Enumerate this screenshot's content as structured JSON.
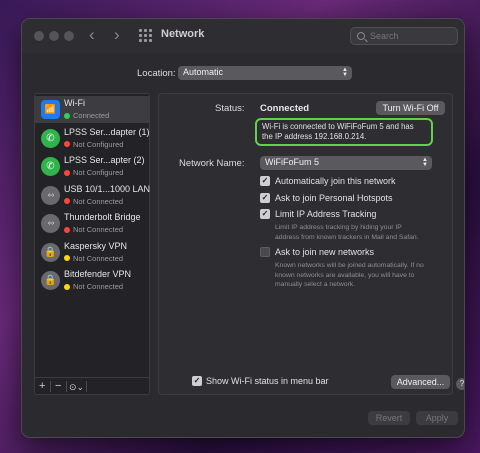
{
  "window": {
    "title": "Network",
    "search_placeholder": "Search"
  },
  "location": {
    "label": "Location:",
    "value": "Automatic"
  },
  "services": [
    {
      "name": "Wi-Fi",
      "status": "Connected",
      "status_color": "#30d158",
      "icon": "wifi-icon",
      "icon_bg": "#1f7bf2"
    },
    {
      "name": "LPSS Ser...dapter (1)",
      "status": "Not Configured",
      "status_color": "#ff453a",
      "icon": "phone-icon",
      "icon_bg": "#30b34a"
    },
    {
      "name": "LPSS Ser...apter (2)",
      "status": "Not Configured",
      "status_color": "#ff453a",
      "icon": "phone-icon",
      "icon_bg": "#30b34a"
    },
    {
      "name": "USB 10/1...1000 LAN",
      "status": "Not Connected",
      "status_color": "#ff453a",
      "icon": "ethernet-icon",
      "icon_bg": "#6a696e"
    },
    {
      "name": "Thunderbolt Bridge",
      "status": "Not Connected",
      "status_color": "#ff453a",
      "icon": "ethernet-icon",
      "icon_bg": "#6a696e"
    },
    {
      "name": "Kaspersky VPN",
      "status": "Not Connected",
      "status_color": "#ffd60a",
      "icon": "lock-icon",
      "icon_bg": "#6a696e"
    },
    {
      "name": "Bitdefender VPN",
      "status": "Not Connected",
      "status_color": "#ffd60a",
      "icon": "lock-icon",
      "icon_bg": "#6a696e"
    }
  ],
  "sidebar_footer": {
    "add": "+",
    "remove": "−",
    "action": "⊙⌄"
  },
  "detail": {
    "status_label": "Status:",
    "status_value": "Connected",
    "turn_off_button": "Turn Wi-Fi Off",
    "info_text": "Wi-Fi is connected to WiFiFoFum 5 and has the IP address 192.168.0.214.",
    "network_name_label": "Network Name:",
    "network_name_value": "WiFiFoFum 5",
    "auto_join_label": "Automatically join this network",
    "auto_join_checked": true,
    "hotspots_label": "Ask to join Personal Hotspots",
    "hotspots_checked": true,
    "limit_ip_label": "Limit IP Address Tracking",
    "limit_ip_checked": true,
    "limit_ip_desc": "Limit IP address tracking by hiding your IP address from known trackers in Mail and Safari.",
    "ask_new_label": "Ask to join new networks",
    "ask_new_checked": false,
    "ask_new_desc": "Known networks will be joined automatically. If no known networks are available, you will have to manually select a network.",
    "show_status_label": "Show Wi-Fi status in menu bar",
    "show_status_checked": true,
    "advanced_button": "Advanced...",
    "help_button": "?"
  },
  "footer": {
    "revert_button": "Revert",
    "apply_button": "Apply"
  }
}
